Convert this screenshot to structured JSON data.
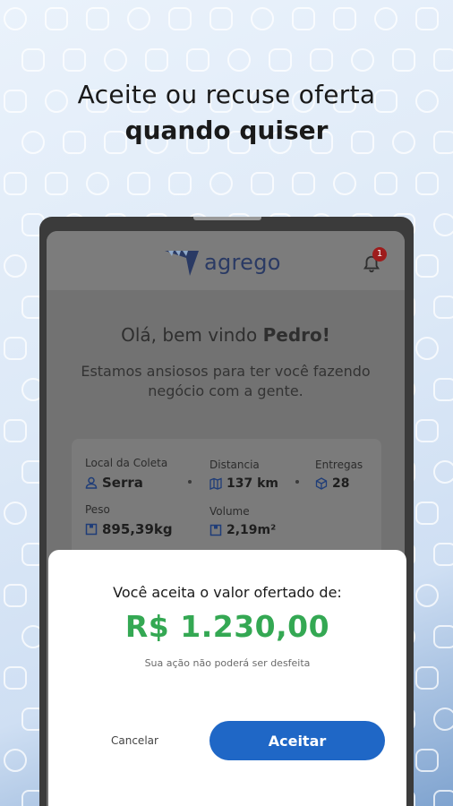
{
  "headline": {
    "line1": "Aceite ou recuse oferta",
    "line2": "quando quiser"
  },
  "app": {
    "logo_text": "agrego",
    "notification_count": "1",
    "welcome_prefix": "Olá, bem vindo ",
    "welcome_name": "Pedro!",
    "subtitle": "Estamos ansiosos para ter você fazendo negócio com a gente.",
    "details": {
      "pickup_label": "Local da Coleta",
      "pickup_value": "Serra",
      "distance_label": "Distancia",
      "distance_value": "137 km",
      "deliveries_label": "Entregas",
      "deliveries_value": "28",
      "weight_label": "Peso",
      "weight_value": "895,39kg",
      "volume_label": "Volume",
      "volume_value": "2,19m²"
    }
  },
  "modal": {
    "question": "Você aceita o valor ofertado de:",
    "price": "R$ 1.230,00",
    "note": "Sua ação não poderá ser desfeita",
    "cancel_label": "Cancelar",
    "accept_label": "Aceitar"
  },
  "colors": {
    "price": "#34a853",
    "accept_button": "#1f67c6",
    "badge": "#9e1c1c"
  }
}
